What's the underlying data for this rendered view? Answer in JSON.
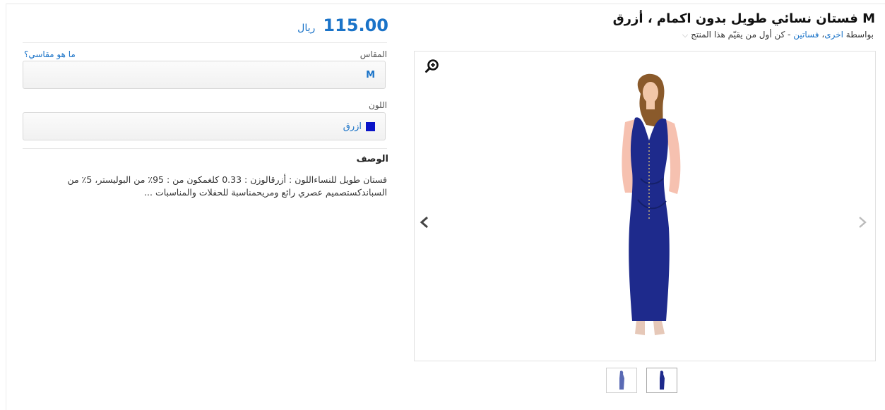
{
  "product": {
    "title": "M فستان نسائي طويل بدون اكمام ، أزرق",
    "byline_prefix": "بواسطة",
    "brand_link": "اخرى",
    "category_link": "فساتين",
    "rating_prompt": "- كن أول من يقيّم هذا المنتج",
    "rating_chevron_icon": "chevron-down-icon"
  },
  "price": {
    "amount": "115.00",
    "currency": "ريال"
  },
  "size": {
    "label": "المقاس",
    "guide_link": "ما هو مقاسي؟",
    "selected": "M"
  },
  "color": {
    "label": "اللون",
    "selected": "ازرق",
    "swatch_hex": "#0a14c8"
  },
  "description": {
    "heading": "الوصف",
    "text": "فستان طويل للنساءاللون : أزرقالوزن : 0.33 كلغمكون من : 95٪ من البوليستر، 5٪ من السباندكستصميم عصري رائع ومريحمناسبة للحفلات والمناسبات ..."
  },
  "gallery": {
    "zoom_icon": "zoom-in-icon",
    "prev_icon": "chevron-left-icon",
    "next_icon": "chevron-right-icon",
    "thumbnail_count": 2,
    "active_thumbnail": 2
  },
  "colors": {
    "accent": "#1a73c8",
    "dress": "#1e2a8c"
  }
}
